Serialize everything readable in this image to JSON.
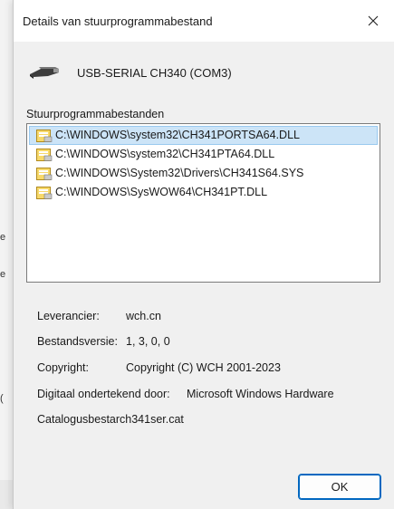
{
  "window": {
    "title": "Details van stuurprogrammabestand",
    "close_icon": "close-icon"
  },
  "device": {
    "name": "USB-SERIAL CH340 (COM3)",
    "icon": "usb-cable-icon"
  },
  "files_section": {
    "label": "Stuurprogrammabestanden",
    "items": [
      {
        "path": "C:\\WINDOWS\\system32\\CH341PORTSA64.DLL",
        "selected": true
      },
      {
        "path": "C:\\WINDOWS\\system32\\CH341PTA64.DLL",
        "selected": false
      },
      {
        "path": "C:\\WINDOWS\\System32\\Drivers\\CH341S64.SYS",
        "selected": false
      },
      {
        "path": "C:\\WINDOWS\\SysWOW64\\CH341PT.DLL",
        "selected": false
      }
    ]
  },
  "properties": {
    "provider_label": "Leverancier:",
    "provider_value": "wch.cn",
    "version_label": "Bestandsversie:",
    "version_value": "1, 3, 0, 0",
    "copyright_label": "Copyright:",
    "copyright_value": "Copyright (C) WCH 2001-2023",
    "signer_label": "Digitaal ondertekend door:",
    "signer_value": "Microsoft Windows Hardware",
    "catalog_text": "Catalogusbestarch341ser.cat"
  },
  "buttons": {
    "ok_label": "OK"
  },
  "background_fragments": [
    "e",
    "e",
    "("
  ],
  "colors": {
    "selection": "#cce4f7",
    "accent": "#0067c0"
  }
}
